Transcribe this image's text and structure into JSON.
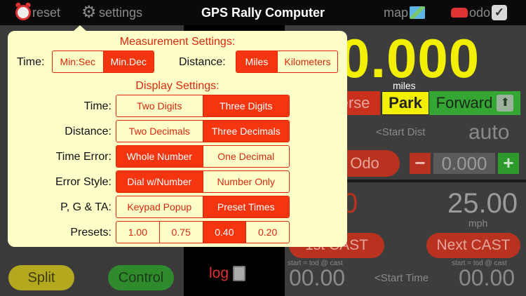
{
  "topbar": {
    "reset": "reset",
    "settings": "settings",
    "title": "GPS Rally Computer",
    "map": "map",
    "odo": "odo"
  },
  "background": {
    "distance": "0.000",
    "distance_unit": "miles",
    "reverse": "erse",
    "park": "Park",
    "forward": "Forward",
    "start_dist": "<Start Dist",
    "auto": "auto",
    "odo_button": "Odo",
    "odo_minus": "−",
    "odo_value": "0.000",
    "odo_plus": "+",
    "red_value": "0",
    "speed": "25.00",
    "speed_unit": "mph",
    "first_cast": "1st CAST",
    "next_cast": "Next CAST",
    "start_note_1": "start = tod @ cast",
    "start_note_2": "start = tod @ cast",
    "time_left": "00.00",
    "time_right": "00.00",
    "start_time": "<Start Time",
    "split": "Split",
    "control": "Control",
    "log": "log"
  },
  "popover": {
    "measurement_title": "Measurement Settings:",
    "display_title": "Display Settings:",
    "measurement": {
      "time": {
        "label": "Time:",
        "options": [
          "Min:Sec",
          "Min.Dec"
        ],
        "selected": 1
      },
      "distance": {
        "label": "Distance:",
        "options": [
          "Miles",
          "Kilometers"
        ],
        "selected": 0
      }
    },
    "display": [
      {
        "label": "Time:",
        "options": [
          "Two Digits",
          "Three Digits"
        ],
        "selected": 1
      },
      {
        "label": "Distance:",
        "options": [
          "Two Decimals",
          "Three Decimals"
        ],
        "selected": 1
      },
      {
        "label": "Time Error:",
        "options": [
          "Whole Number",
          "One Decimal"
        ],
        "selected": 0
      },
      {
        "label": "Error Style:",
        "options": [
          "Dial w/Number",
          "Number Only"
        ],
        "selected": 0
      },
      {
        "label": "P, G & TA:",
        "options": [
          "Keypad Popup",
          "Preset Times"
        ],
        "selected": 1
      },
      {
        "label": "Presets:",
        "options": [
          "1.00",
          "0.75",
          "0.40",
          "0.20"
        ],
        "selected": 2
      }
    ]
  },
  "colors": {
    "accent_red": "#f5350f",
    "popover_bg": "#fefec8",
    "distance_yellow": "#f2f000"
  }
}
